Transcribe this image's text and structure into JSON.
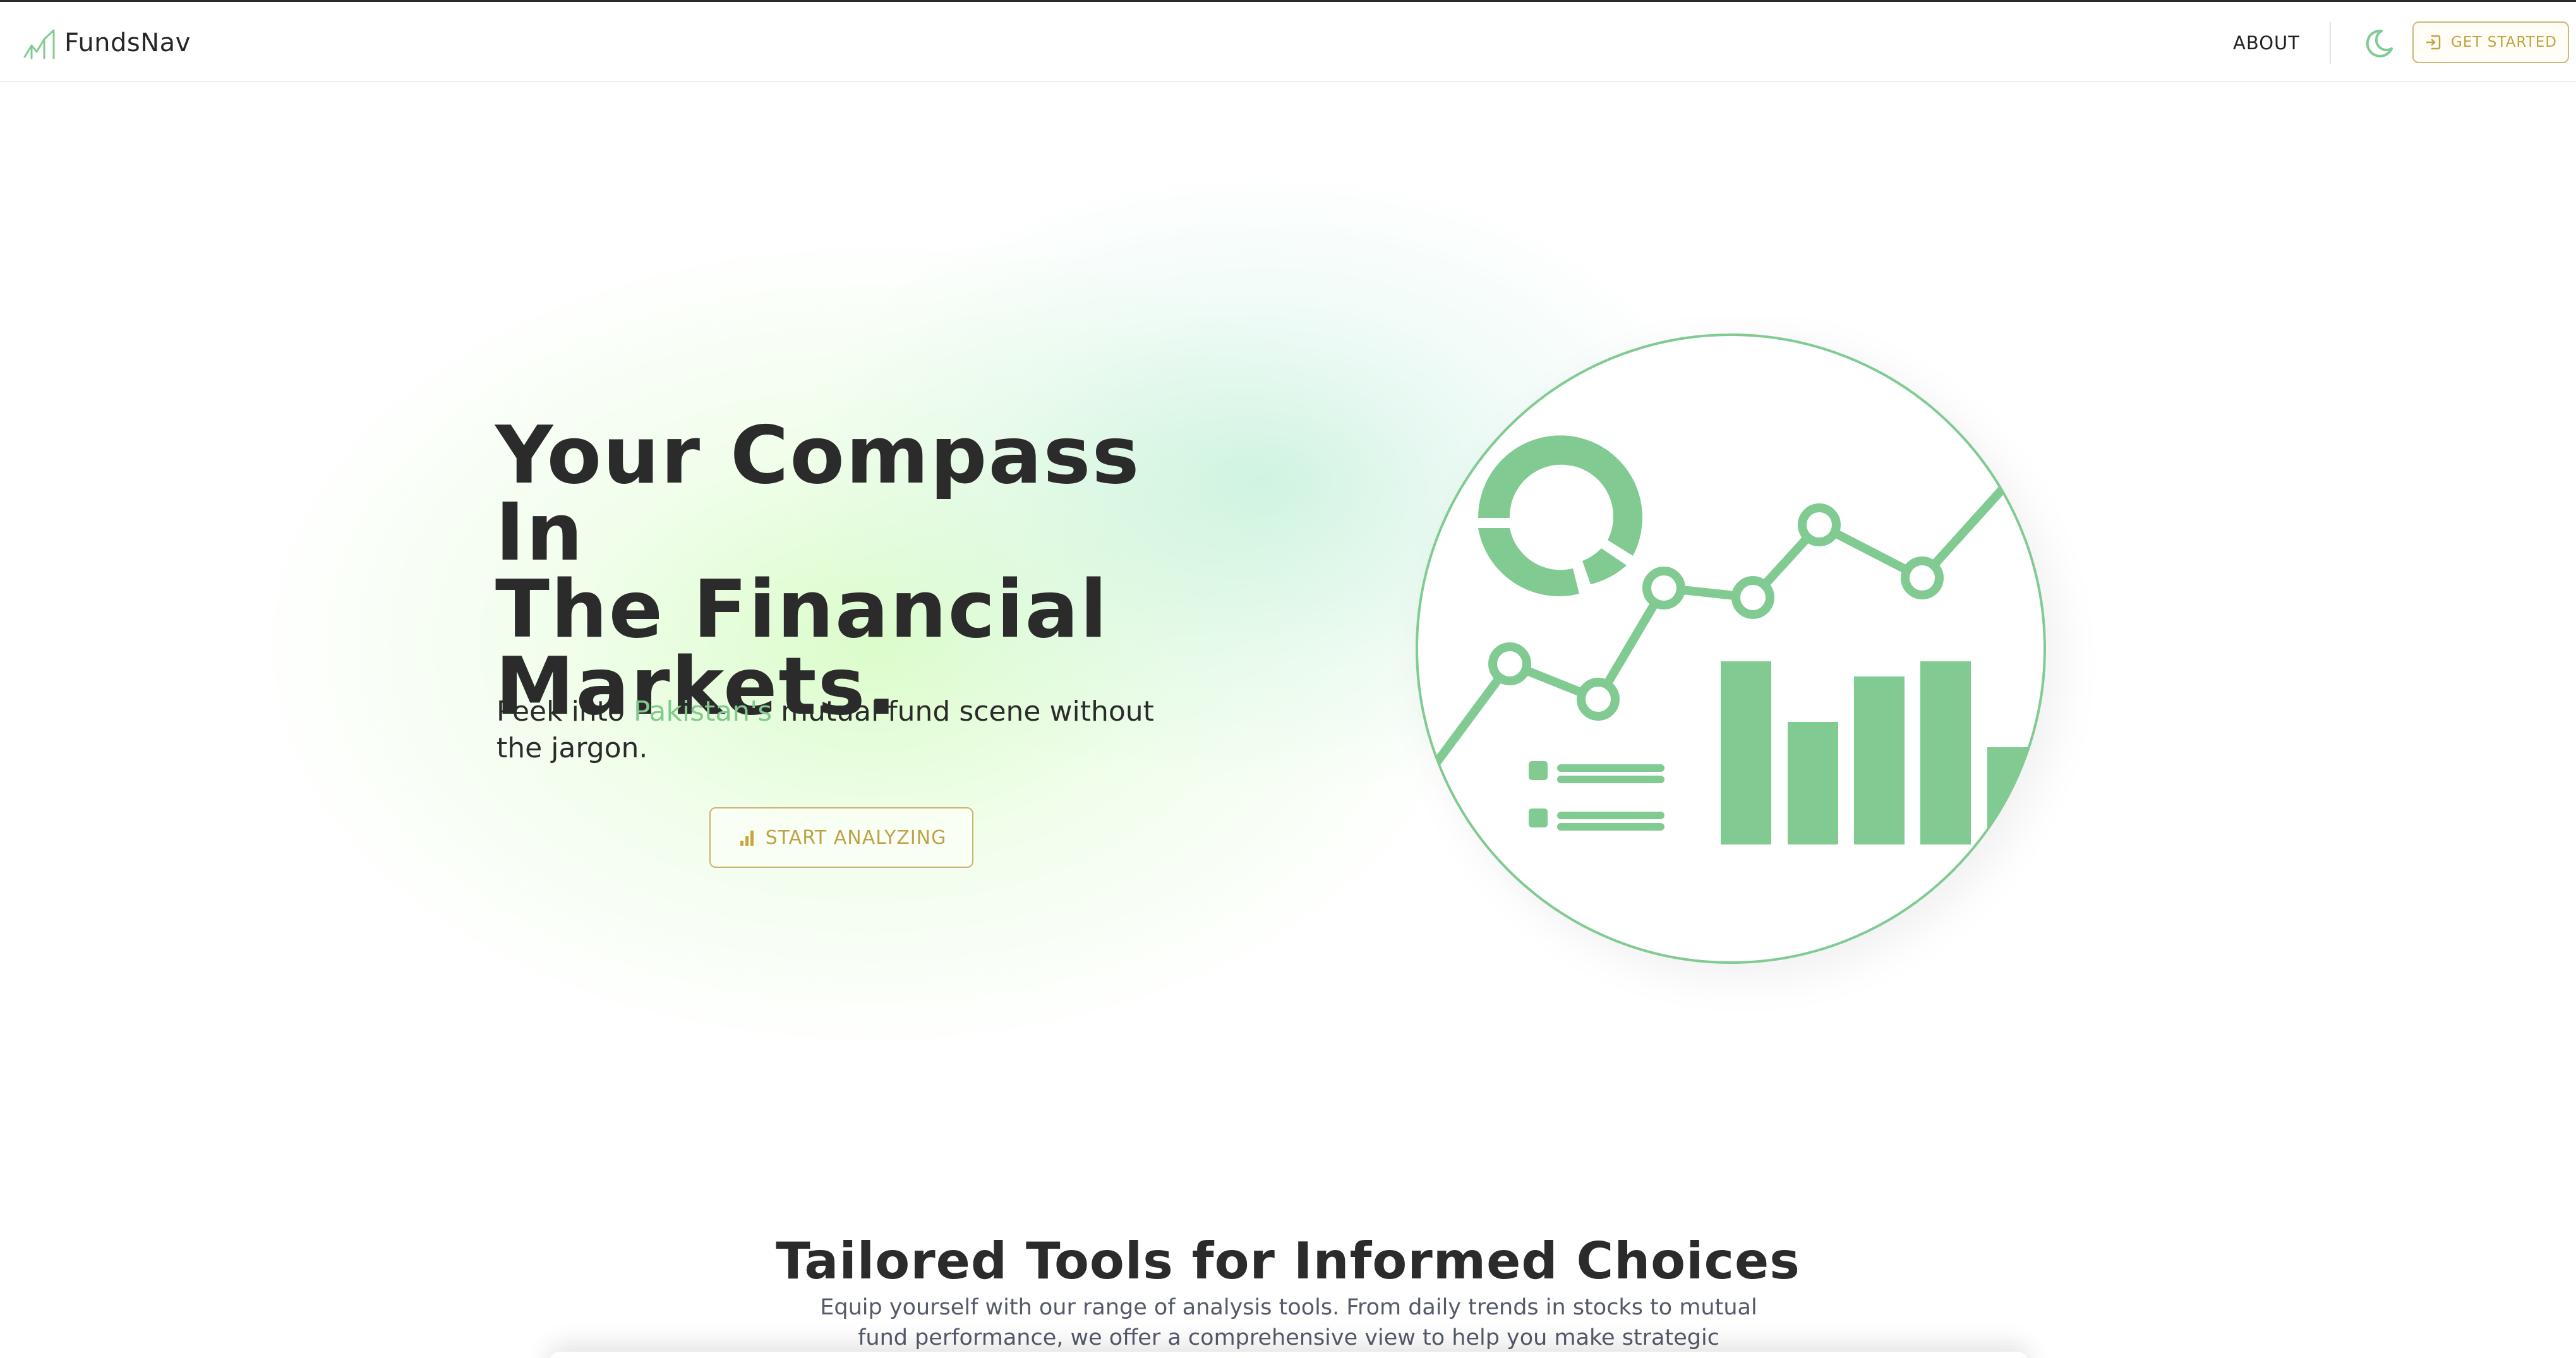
{
  "colors": {
    "accent_green": "#81CB93",
    "button_gold": "#C1A33E",
    "text_dark": "#2B2B2B"
  },
  "nav": {
    "brand": "FundsNav",
    "brand_icon": "line-chart-icon",
    "about": "ABOUT",
    "theme_icon": "moon-icon",
    "get_started": "GET STARTED",
    "get_started_icon": "login-icon"
  },
  "hero": {
    "title_line1": "Your Compass In",
    "title_line2": "The Financial",
    "title_line3": "Markets.",
    "subtitle_before": "Peek into ",
    "subtitle_highlight": "Pakistan's",
    "subtitle_after": " mutual fund scene without the jargon.",
    "cta": "START ANALYZING",
    "cta_icon": "bar-chart-icon",
    "illustration": "analytics-illustration"
  },
  "section": {
    "title": "Tailored Tools for Informed Choices",
    "description": "Equip yourself with our range of analysis tools. From daily trends in stocks to mutual fund performance, we offer a comprehensive view to help you make strategic decisions."
  }
}
